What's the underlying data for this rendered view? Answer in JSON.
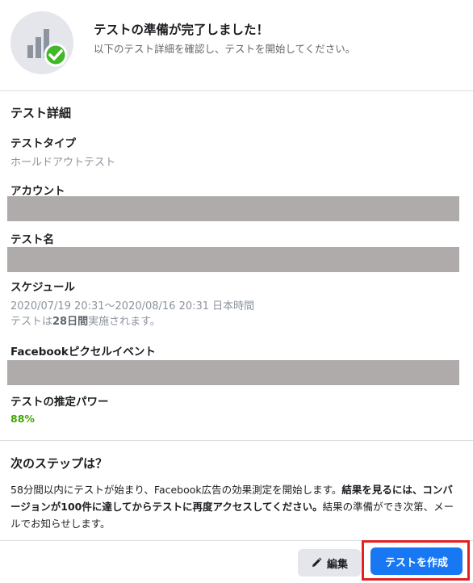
{
  "header": {
    "title": "テストの準備が完了しました！",
    "subtitle": "以下のテスト詳細を確認し、テストを開始してください。",
    "icon": "chart-check-icon"
  },
  "details": {
    "section_title": "テスト詳細",
    "test_type_label": "テストタイプ",
    "test_type_value": "ホールドアウトテスト",
    "account_label": "アカウント",
    "test_name_label": "テスト名",
    "schedule_label": "スケジュール",
    "schedule_range": "2020/07/19 20:31〜2020/08/16 20:31 日本時間",
    "schedule_note_prefix": "テストは",
    "schedule_note_duration": "28日間",
    "schedule_note_suffix": "実施されます。",
    "pixel_event_label": "Facebookピクセルイベント",
    "power_label": "テストの推定パワー",
    "power_value": "88%"
  },
  "next_steps": {
    "title": "次のステップは？",
    "text_1": "58分間以内にテストが始まり、Facebook広告の効果測定を開始します。",
    "text_bold": "結果を見るには、コンバージョンが100件に達してからテストに再度アクセスしてください。",
    "text_2": "結果の準備ができ次第、メールでお知らせします。"
  },
  "footer": {
    "edit_label": "編集",
    "create_label": "テストを作成"
  },
  "colors": {
    "primary": "#1877f2",
    "power_green": "#42a600",
    "redaction": "#afabab",
    "highlight": "#e41f1f"
  }
}
